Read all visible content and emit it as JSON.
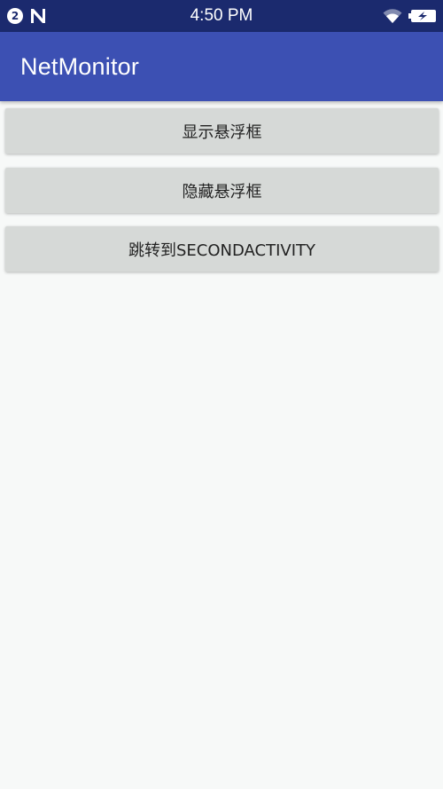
{
  "status_bar": {
    "notification_count": "2",
    "time": "4:50 PM",
    "icons": [
      "n-icon",
      "wifi-icon",
      "battery-charging-icon"
    ]
  },
  "app_bar": {
    "title": "NetMonitor",
    "color": "#3c50b3"
  },
  "buttons": {
    "show_float": "显示悬浮框",
    "hide_float": "隐藏悬浮框",
    "goto_second": "跳转到SECONDACTIVITY"
  },
  "colors": {
    "status_bar": "#1b2a6e",
    "button_bg": "#d6d9d7",
    "background": "#f7f9f8"
  }
}
